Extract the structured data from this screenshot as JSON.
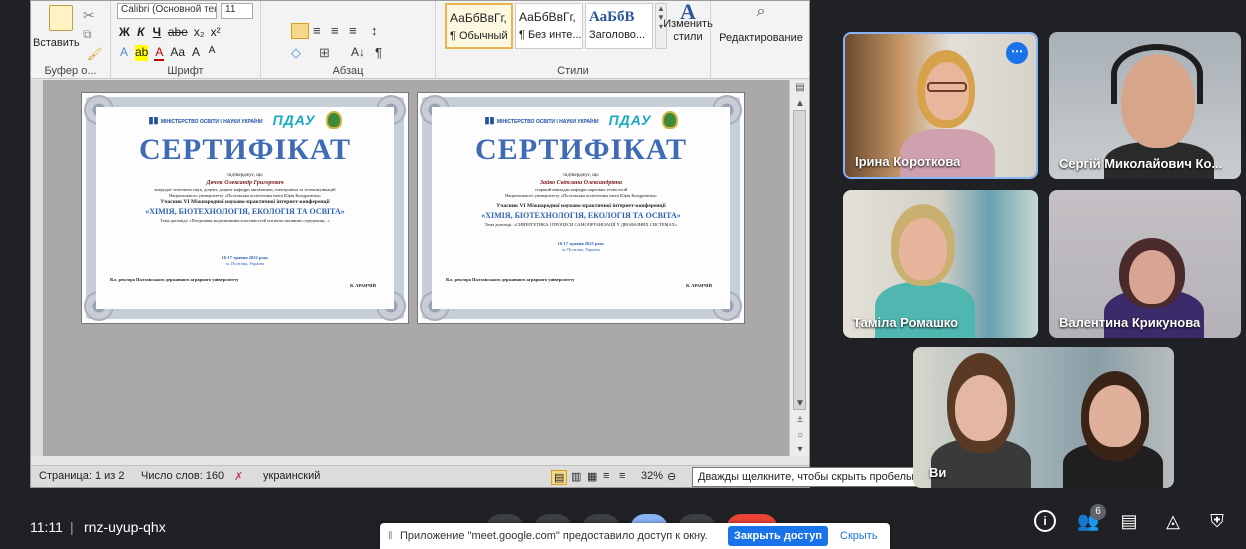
{
  "word": {
    "ribbon": {
      "paste_label": "Вставить",
      "font_name": "Calibri (Основной тек",
      "font_size": "11",
      "groups": {
        "clipboard": "Буфер о...",
        "font": "Шрифт",
        "paragraph": "Абзац",
        "styles": "Стили"
      },
      "font_tools": [
        "Ж",
        "К",
        "Ч",
        "abe",
        "x₂",
        "x²"
      ],
      "font_tools2": [
        "A",
        "ab",
        "A",
        "Aa",
        "A",
        "A"
      ],
      "styles": [
        {
          "preview": "АаБбВвГг,",
          "label": "¶ Обычный",
          "selected": true
        },
        {
          "preview": "АаБбВвГг,",
          "label": "¶ Без инте...",
          "selected": false
        },
        {
          "preview": "АаБбВ",
          "label": "Заголово...",
          "selected": false
        }
      ],
      "change_styles": "Изменить стили",
      "editing": "Редактирование"
    },
    "certificates": [
      {
        "title": "СЕРТИФІКАТ",
        "confirms": "підтверджує, що",
        "person": "Дячок Олександр Григорович",
        "position": "кандидат технічних наук, доцент, доцент кафедри автоматики, електроніки та телекомунікацій",
        "university": "Національного університету «Полтавська політехніка імені Юрія Кондратюка»",
        "event": "Учасник VI Міжнародної науково-практичної інтернет-конференції",
        "conference": "«ХІМІЯ, БІОТЕХНОЛОГІЯ, ЕКОЛОГІЯ ТА ОСВІТА»",
        "topic": "Тема доповіді: «Поєднання моделювання властивостей оптично-активних середовищ...»",
        "date": "16-17 травня 2022 року",
        "city": "м. Полтава, Україна",
        "signer_title": "В.о. ректора Полтавського державного аграрного університету",
        "signer_name": "В. АРАНЧІЙ"
      },
      {
        "title": "СЕРТИФІКАТ",
        "confirms": "підтверджує, що",
        "person": "Зайко Світлана Олександрівна",
        "position": "старший викладач кафедри харчових технологій",
        "university": "Національного університету «Полтавська політехніка імені Юрія Кондратюка»",
        "event": "Учасник VI Міжнародної науково-практичної інтернет-конференції",
        "conference": "«ХІМІЯ, БІОТЕХНОЛОГІЯ, ЕКОЛОГІЯ ТА ОСВІТА»",
        "topic": "Тема доповіді: «СИНЕРГЕТИКА І ПРОЦЕСИ САМООРГАНІЗАЦІЇ У ДВОФАЗНИХ СИСТЕМАХ»",
        "date": "16-17 травня 2022 року",
        "city": "м. Полтава, Україна",
        "signer_title": "В.о. ректора Полтавського державного аграрного університету",
        "signer_name": "В. АРАНЧІЙ"
      }
    ],
    "logos": {
      "ministry": "МІНІСТЕРСТВО ОСВІТИ І НАУКИ УКРАЇНИ",
      "brand": "ПДАУ"
    },
    "status": {
      "page": "Страница: 1 из 2",
      "words": "Число слов: 160",
      "language": "украинский",
      "zoom": "32%"
    },
    "tooltip": "Дважды щелкните, чтобы скрыть пробелы"
  },
  "participants": [
    {
      "name": "Ірина Короткова",
      "colors": {
        "bg": "#7a5a3a",
        "skin": "#e8b69a",
        "hair": "#d8a24a",
        "clothes": "#c9a0a8"
      }
    },
    {
      "name": "Сергій Миколайович Ко...",
      "colors": {
        "bg": "#b8bcc0",
        "skin": "#d7a58a",
        "hair": "#8a8a8a",
        "clothes": "#2a2a2a"
      }
    },
    {
      "name": "Таміла Ромашко",
      "colors": {
        "bg": "#d9d7cf",
        "skin": "#e6b59b",
        "hair": "#c9b070",
        "clothes": "#4fb7b0"
      }
    },
    {
      "name": "Валентина Крикунова",
      "colors": {
        "bg": "#bfbcc0",
        "skin": "#d9a592",
        "hair": "#4a2a2a",
        "clothes": "#3b2b6a"
      }
    },
    {
      "name": "Ви",
      "colors": {
        "bg": "#8aa0a8",
        "skin": "#e3b7a2",
        "hair": "#5a3a25",
        "clothes": "#2a2a2a"
      }
    }
  ],
  "meeting": {
    "time": "11:11",
    "separator": "|",
    "code": "rnz-uyup-qhx",
    "people_count": "6"
  },
  "share_notice": {
    "text": "Приложение \"meet.google.com\" предоставило доступ к окну.",
    "stop": "Закрыть доступ",
    "hide": "Скрыть"
  }
}
